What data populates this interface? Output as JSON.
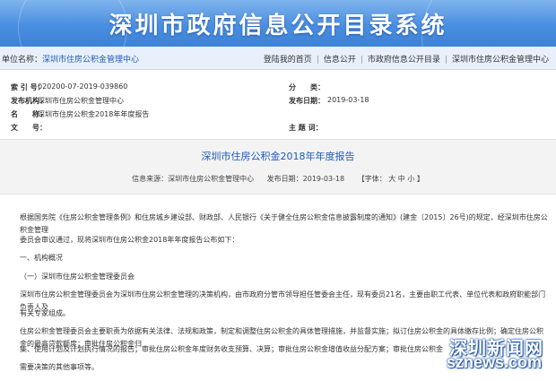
{
  "banner": {
    "title": "深圳市政府信息公开目录系统"
  },
  "navbar": {
    "unit_label": "单位名称：",
    "unit_value": "深圳市住房公积金管理中心",
    "links": [
      "登陆我的首页",
      "信息公开",
      "市政府信息公开目录",
      "深圳市住房公积金管理中心"
    ]
  },
  "meta": {
    "index_label": "索 引 号：",
    "index_value": "020200-07-2019-039860",
    "category_label": "分　　类：",
    "category_value": "",
    "org_label": "发布机构：",
    "org_value": "深圳市住房公积金管理中心",
    "date_label": "发布日期：",
    "date_value": "2019-03-18",
    "name_label": "名　　称：",
    "name_value": "深圳市住房公积金2018年年度报告",
    "docno_label": "文　　号：",
    "docno_value": "",
    "keyword_label": "主 题 词：",
    "keyword_value": ""
  },
  "article": {
    "title": "深圳市住房公积金2018年年度报告",
    "source": "信息来源：深圳市住房公积金管理中心",
    "pubdate": "发布日期：2019-03-18",
    "fontsize": "【字体： 大  中  小 】",
    "paragraphs": [
      "根据国务院《住房公积金管理条例》和住房城乡建设部、财政部、人民银行《关于健全住房公积金信息披露制度的通知》(建金〔2015〕26号)的规定，经深圳市住房公积金管理",
      "委员会审议通过，现将深圳市住房公积金2018年年度报告公布如下：",
      "一、机构概况",
      "（一）深圳市住房公积金管理委员会",
      "深圳市住房公积金管理委员会为深圳市住房公积金管理的决策机构，由市政府分管市领导担任管委会主任，现有委员21名，主要由职工代表、单位代表和政府职能部门负责人及",
      "有关专家组成。",
      "住房公积金管理委员会主要职责为依据有关法律、法规和政策，制定和调整住房公积金的具体管理措施，并监督实施；拟订住房公积金的具体缴存比例；确定住房公积金的最高贷款额度；审批住房公积金归",
      "集、使用计划及计划执行情况的报告；审批住房公积金年度财务收支预算、决算；审批住房公积金增值收益分配方案；审批住房公积金",
      "需要决策的其他事项等。"
    ]
  },
  "watermark": {
    "cn": "深圳新闻网",
    "en": "sznews.com"
  },
  "colors": {
    "banner": "#4a8ee0",
    "link": "#1f5ab8",
    "band": "#f3f3f3"
  }
}
